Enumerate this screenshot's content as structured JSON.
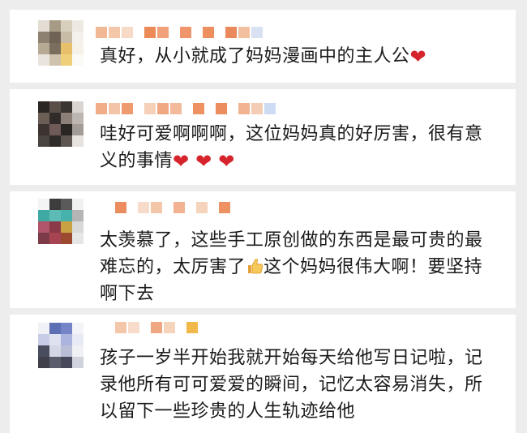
{
  "comments": [
    {
      "text": "真好，从小就成了妈妈漫画中的主人公",
      "emojis": [
        "red-heart"
      ]
    },
    {
      "text": "哇好可爱啊啊啊，这位妈妈真的好厉害，很有意义的事情",
      "emojis": [
        "red-heart",
        "red-heart",
        "red-heart"
      ]
    },
    {
      "text_before_emoji": "太羡慕了，这些手工原创做的东西是最可贵的最难忘的，太厉害了",
      "text_after_emoji": "这个妈妈很伟大啊！要坚持啊下去",
      "emoji": "thumbs-up"
    },
    {
      "text": "孩子一岁半开始我就开始每天给他写日记啦，记录他所有可可爱爱的瞬间，记忆太容易消失，所以留下一些珍贵的人生轨迹给他"
    }
  ],
  "heart_glyph": "❤",
  "colors": {
    "background": "#ededed",
    "card": "#ffffff",
    "text": "#1a1a1a",
    "heart": "#d6242c"
  }
}
